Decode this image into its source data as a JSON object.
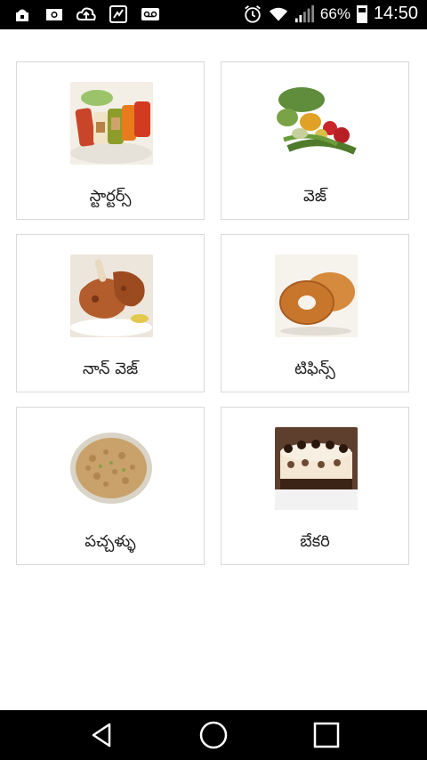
{
  "status_bar": {
    "icons_left": [
      "android-icon",
      "image-icon",
      "cloud-upload-icon",
      "phone-missed-icon",
      "voicemail-icon"
    ],
    "icons_right": [
      "alarm-icon",
      "wifi-icon",
      "signal-icon"
    ],
    "battery_percent_text": "66%",
    "battery_level": 0.66,
    "time": "14:50"
  },
  "categories": [
    {
      "label": "స్టార్టర్స్",
      "image": "starters-image"
    },
    {
      "label": "వెజ్",
      "image": "veg-image"
    },
    {
      "label": "నాన్ వెజ్",
      "image": "non-veg-image"
    },
    {
      "label": "టిఫిన్స్",
      "image": "tiffins-image"
    },
    {
      "label": "పచ్చళ్ళు",
      "image": "pickles-image"
    },
    {
      "label": "బేకరి",
      "image": "bakery-image"
    }
  ],
  "nav_bar": {
    "buttons": [
      "back-icon",
      "home-icon",
      "recents-icon"
    ]
  }
}
